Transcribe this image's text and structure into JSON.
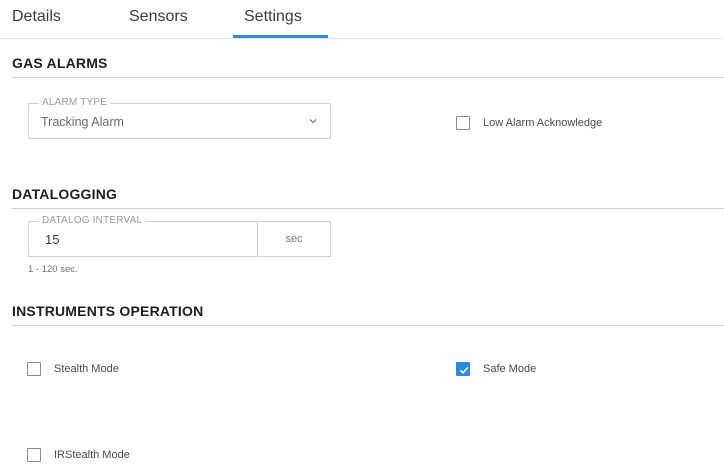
{
  "tabs": {
    "details": "Details",
    "sensors": "Sensors",
    "settings": "Settings",
    "active": "Settings"
  },
  "gas_alarms": {
    "title": "GAS ALARMS",
    "alarm_type": {
      "legend": "ALARM TYPE",
      "value": "Tracking Alarm"
    },
    "low_alarm_ack": {
      "label": "Low Alarm Acknowledge",
      "checked": false
    }
  },
  "datalogging": {
    "title": "DATALOGGING",
    "interval": {
      "legend": "DATALOG INTERVAL",
      "value": "15",
      "unit": "sec",
      "hint": "1 - 120 sec."
    }
  },
  "instruments_operation": {
    "title": "INSTRUMENTS OPERATION",
    "stealth_mode": {
      "label": "Stealth Mode",
      "checked": false
    },
    "safe_mode": {
      "label": "Safe Mode",
      "checked": true
    },
    "irstealth_mode": {
      "label": "IRStealth Mode",
      "checked": false
    }
  },
  "colors": {
    "accent": "#2b8be0",
    "divider": "#d0d0d0"
  }
}
